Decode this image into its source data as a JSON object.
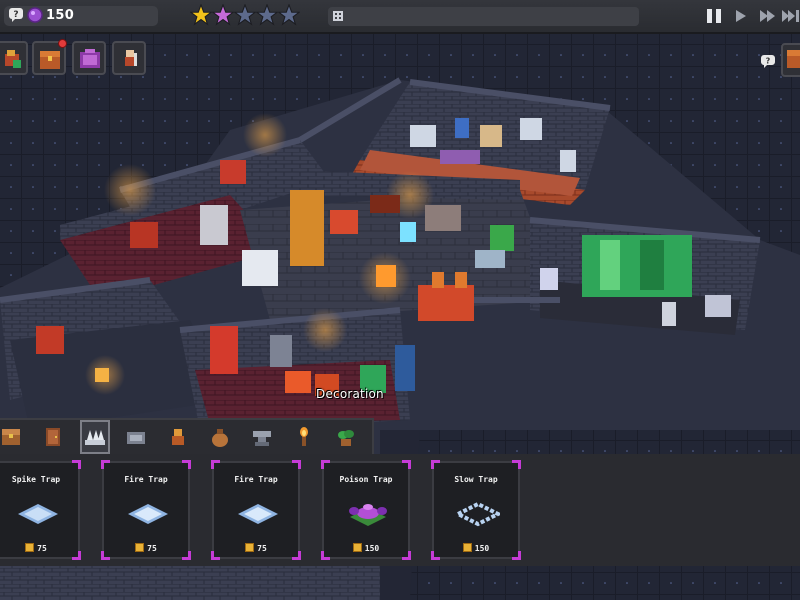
{
  "hud": {
    "resource_amount": "150",
    "rating": {
      "filled": 2,
      "total": 5
    },
    "speed_controls": [
      "pause-icon",
      "play-icon",
      "fast-forward-icon",
      "fastest-forward-icon"
    ]
  },
  "menu_buttons": [
    "build-menu-icon",
    "treasure-chest-icon",
    "monster-cage-icon",
    "worker-icon"
  ],
  "world_label": "Decoration",
  "categories": [
    {
      "icon": "chest-icon",
      "active": false
    },
    {
      "icon": "door-icon",
      "active": false
    },
    {
      "icon": "spike-trap-icon",
      "active": true
    },
    {
      "icon": "pressure-plate-icon",
      "active": false
    },
    {
      "icon": "monster-icon",
      "active": false
    },
    {
      "icon": "loot-bag-icon",
      "active": false
    },
    {
      "icon": "anvil-icon",
      "active": false
    },
    {
      "icon": "torch-icon",
      "active": false
    },
    {
      "icon": "plant-icon",
      "active": false
    }
  ],
  "items": [
    {
      "name": "Spike Trap",
      "cost": "75",
      "icon": "spike-trap-icon"
    },
    {
      "name": "Fire Trap",
      "cost": "75",
      "icon": "fire-trap-icon"
    },
    {
      "name": "Fire Trap",
      "cost": "75",
      "icon": "fire-trap-icon"
    },
    {
      "name": "Poison Trap",
      "cost": "150",
      "icon": "poison-trap-icon"
    },
    {
      "name": "Slow Trap",
      "cost": "150",
      "icon": "slow-trap-icon"
    }
  ],
  "colors": {
    "accent": "#c53bd6",
    "coin": "#e9b236",
    "star_filled": "#f2c21b",
    "star_purple": "#c56ad8",
    "star_empty": "#5d6a8c"
  }
}
